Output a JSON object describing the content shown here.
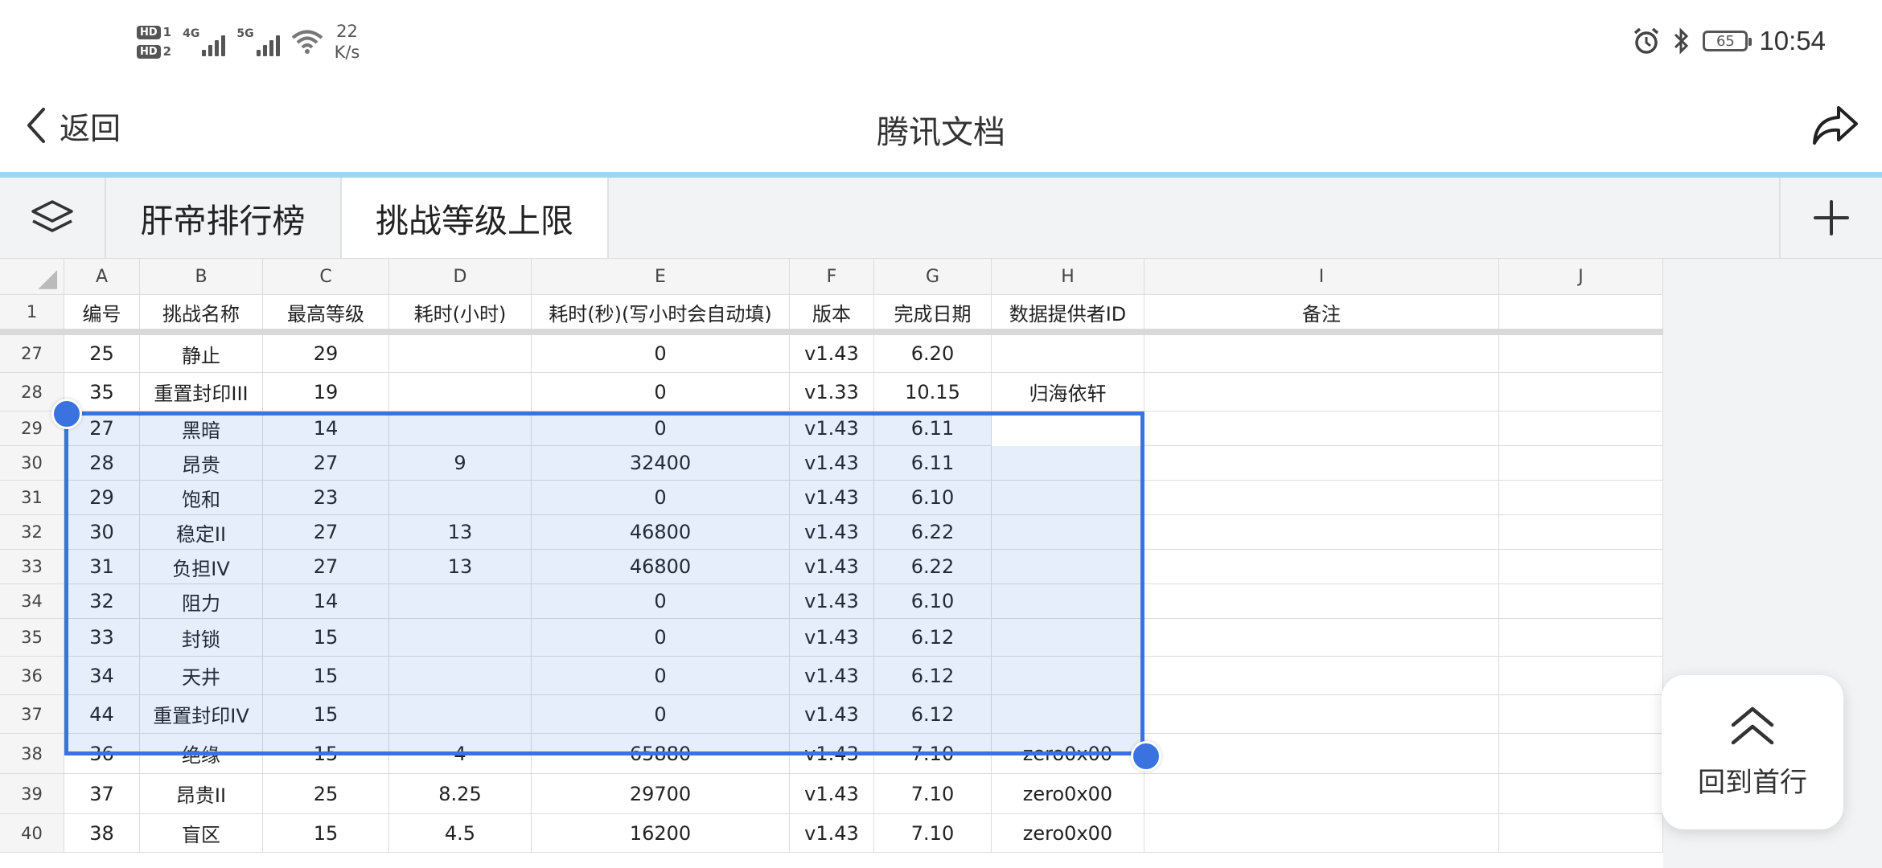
{
  "status_bar": {
    "sim1": "HD",
    "sim1_num": "1",
    "sim2": "HD",
    "sim2_num": "2",
    "net1": "4G",
    "net2": "5G",
    "speed_value": "22",
    "speed_unit": "K/s",
    "battery": "65",
    "time": "10:54"
  },
  "header": {
    "back_label": "返回",
    "title": "腾讯文档"
  },
  "tabs": [
    {
      "label": "肝帝排行榜"
    },
    {
      "label": "挑战等级上限"
    }
  ],
  "columns": [
    "A",
    "B",
    "C",
    "D",
    "E",
    "F",
    "G",
    "H",
    "I",
    "J"
  ],
  "header_row": {
    "row": "1",
    "cells": [
      "编号",
      "挑战名称",
      "最高等级",
      "耗时(小时)",
      "耗时(秒)(写小时会自动填)",
      "版本",
      "完成日期",
      "数据提供者ID",
      "备注",
      ""
    ]
  },
  "rows": [
    {
      "row": "27",
      "cells": [
        "25",
        "静止",
        "29",
        "",
        "0",
        "v1.43",
        "6.20",
        "",
        "",
        ""
      ]
    },
    {
      "row": "28",
      "cells": [
        "35",
        "重置封印III",
        "19",
        "",
        "0",
        "v1.33",
        "10.15",
        "归海依轩",
        "",
        ""
      ]
    },
    {
      "row": "29",
      "cells": [
        "27",
        "黑暗",
        "14",
        "",
        "0",
        "v1.43",
        "6.11",
        "",
        "",
        ""
      ]
    },
    {
      "row": "30",
      "cells": [
        "28",
        "昂贵",
        "27",
        "9",
        "32400",
        "v1.43",
        "6.11",
        "",
        "",
        ""
      ]
    },
    {
      "row": "31",
      "cells": [
        "29",
        "饱和",
        "23",
        "",
        "0",
        "v1.43",
        "6.10",
        "",
        "",
        ""
      ]
    },
    {
      "row": "32",
      "cells": [
        "30",
        "稳定II",
        "27",
        "13",
        "46800",
        "v1.43",
        "6.22",
        "",
        "",
        ""
      ]
    },
    {
      "row": "33",
      "cells": [
        "31",
        "负担IV",
        "27",
        "13",
        "46800",
        "v1.43",
        "6.22",
        "",
        "",
        ""
      ]
    },
    {
      "row": "34",
      "cells": [
        "32",
        "阻力",
        "14",
        "",
        "0",
        "v1.43",
        "6.10",
        "",
        "",
        ""
      ]
    },
    {
      "row": "35",
      "cells": [
        "33",
        "封锁",
        "15",
        "",
        "0",
        "v1.43",
        "6.12",
        "",
        "",
        ""
      ]
    },
    {
      "row": "36",
      "cells": [
        "34",
        "天井",
        "15",
        "",
        "0",
        "v1.43",
        "6.12",
        "",
        "",
        ""
      ]
    },
    {
      "row": "37",
      "cells": [
        "44",
        "重置封印IV",
        "15",
        "",
        "0",
        "v1.43",
        "6.12",
        "",
        "",
        ""
      ]
    },
    {
      "row": "38",
      "cells": [
        "36",
        "绝缘",
        "15",
        "4",
        "65880",
        "v1.43",
        "7.10",
        "zero0x00",
        "",
        ""
      ]
    },
    {
      "row": "39",
      "cells": [
        "37",
        "昂贵II",
        "25",
        "8.25",
        "29700",
        "v1.43",
        "7.10",
        "zero0x00",
        "",
        ""
      ]
    },
    {
      "row": "40",
      "cells": [
        "38",
        "盲区",
        "15",
        "4.5",
        "16200",
        "v1.43",
        "7.10",
        "zero0x00",
        "",
        ""
      ]
    }
  ],
  "back_to_top": {
    "label": "回到首行"
  },
  "colors": {
    "selection": "#3a73e0",
    "progress": "#9fd6f2",
    "tab_bar": "#f2f3f5"
  },
  "icons": {
    "back": "chevron-left-icon",
    "share": "share-icon",
    "layers": "layers-icon",
    "add": "plus-icon",
    "to_top": "double-chevron-up-icon"
  }
}
